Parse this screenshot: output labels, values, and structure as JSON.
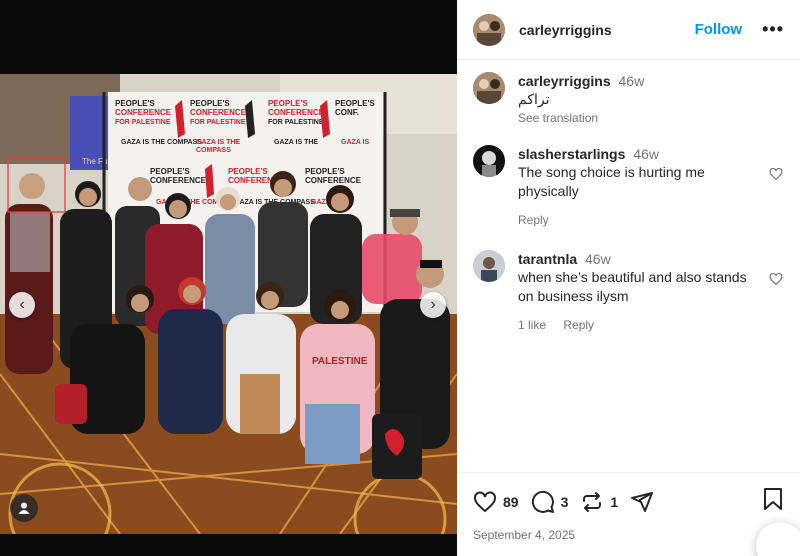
{
  "post": {
    "username": "carleyrriggins",
    "follow_label": "Follow",
    "more_label": "•••"
  },
  "caption": {
    "username": "carleyrriggins",
    "time": "46w",
    "text": "تراكم",
    "see_translation": "See translation"
  },
  "comments": [
    {
      "username": "slasherstarlings",
      "time": "46w",
      "text": "The song choice is hurting me physically",
      "reply": "Reply"
    },
    {
      "username": "tarantnla",
      "time": "46w",
      "text": "when she’s beautiful and also stands on business ilysm",
      "likes": "1 like",
      "reply": "Reply"
    }
  ],
  "actions": {
    "likes": "89",
    "comments": "3",
    "reposts": "1",
    "date": "September 4, 2025"
  },
  "photo": {
    "banner_lines": [
      "PEOPLE'S",
      "CONFERENCE",
      "FOR PALESTINE"
    ],
    "banner_tag": "GAZA IS THE COMPASS",
    "tv_text": "The Fu",
    "shirt_text": "PALESTINE"
  },
  "colors": {
    "accent": "#0095f6",
    "banner_red": "#d3202f",
    "carpet_orange": "#d9822b"
  }
}
